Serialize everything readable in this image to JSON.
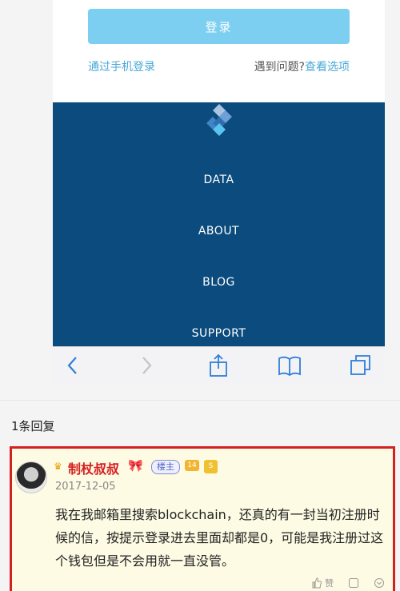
{
  "login": {
    "button_label": "登录",
    "phone_login": "通过手机登录",
    "problem_text": "遇到问题?",
    "options_link": "查看选项"
  },
  "nav": {
    "items": [
      "DATA",
      "ABOUT",
      "BLOG",
      "SUPPORT"
    ]
  },
  "toolbar": {
    "icons": [
      "back-icon",
      "forward-icon",
      "share-icon",
      "bookmarks-icon",
      "tabs-icon"
    ]
  },
  "thread": {
    "reply_count": "1条回复"
  },
  "post": {
    "username": "制杖叔叔",
    "host_badge": "楼主",
    "level": "14",
    "date": "2017-12-05",
    "content": "我在我邮箱里搜索blockchain，还真的有一封当初注册时候的信，按提示登录进去里面却都是0，可能是我注册过这个钱包但是不会用就一直没管。",
    "like_label": "赞"
  },
  "colors": {
    "login_button": "#7ccff0",
    "link": "#4aa8d8",
    "nav_background": "#0b4b7d",
    "post_highlight_border": "#d42020",
    "post_background": "#fdfbe3"
  }
}
